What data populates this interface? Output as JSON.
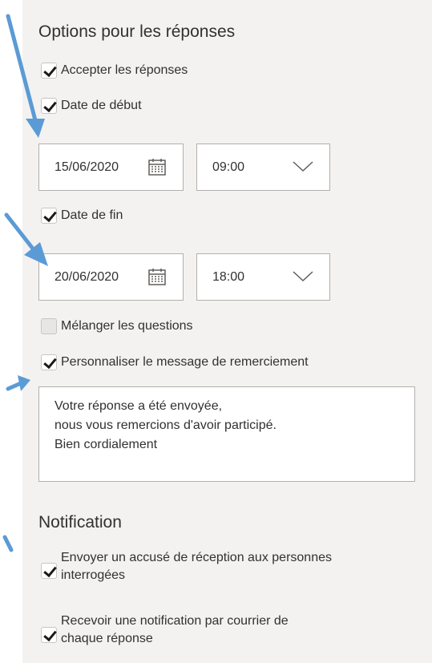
{
  "response_options": {
    "title": "Options pour les réponses",
    "accept_responses": {
      "label": "Accepter les réponses",
      "checked": true
    },
    "start_date": {
      "label": "Date de début",
      "checked": true,
      "date": "15/06/2020",
      "time": "09:00"
    },
    "end_date": {
      "label": "Date de fin",
      "checked": true,
      "date": "20/06/2020",
      "time": "18:00"
    },
    "shuffle_questions": {
      "label": "Mélanger les questions",
      "checked": false
    },
    "custom_thanks": {
      "label": "Personnaliser le message de remerciement",
      "checked": true,
      "message_lines": [
        "Votre réponse a été envoyée,",
        "nous vous remercions d'avoir participé.",
        "Bien cordialement"
      ]
    }
  },
  "notification": {
    "title": "Notification",
    "send_receipt": {
      "label_lines": [
        "Envoyer un accusé de réception aux personnes",
        "interrogées"
      ],
      "checked": true
    },
    "receive_notification": {
      "label_lines": [
        "Recevoir une notification par courrier de",
        "chaque réponse"
      ],
      "checked": true
    }
  },
  "icons": {
    "calendar": "calendar-icon",
    "chevron": "chevron-down-icon",
    "checkbox": "checkmark-icon"
  },
  "colors": {
    "panel_bg": "#f3f2f1",
    "annotation_arrow": "#5b9bd5",
    "field_border": "#b3b0ad"
  }
}
